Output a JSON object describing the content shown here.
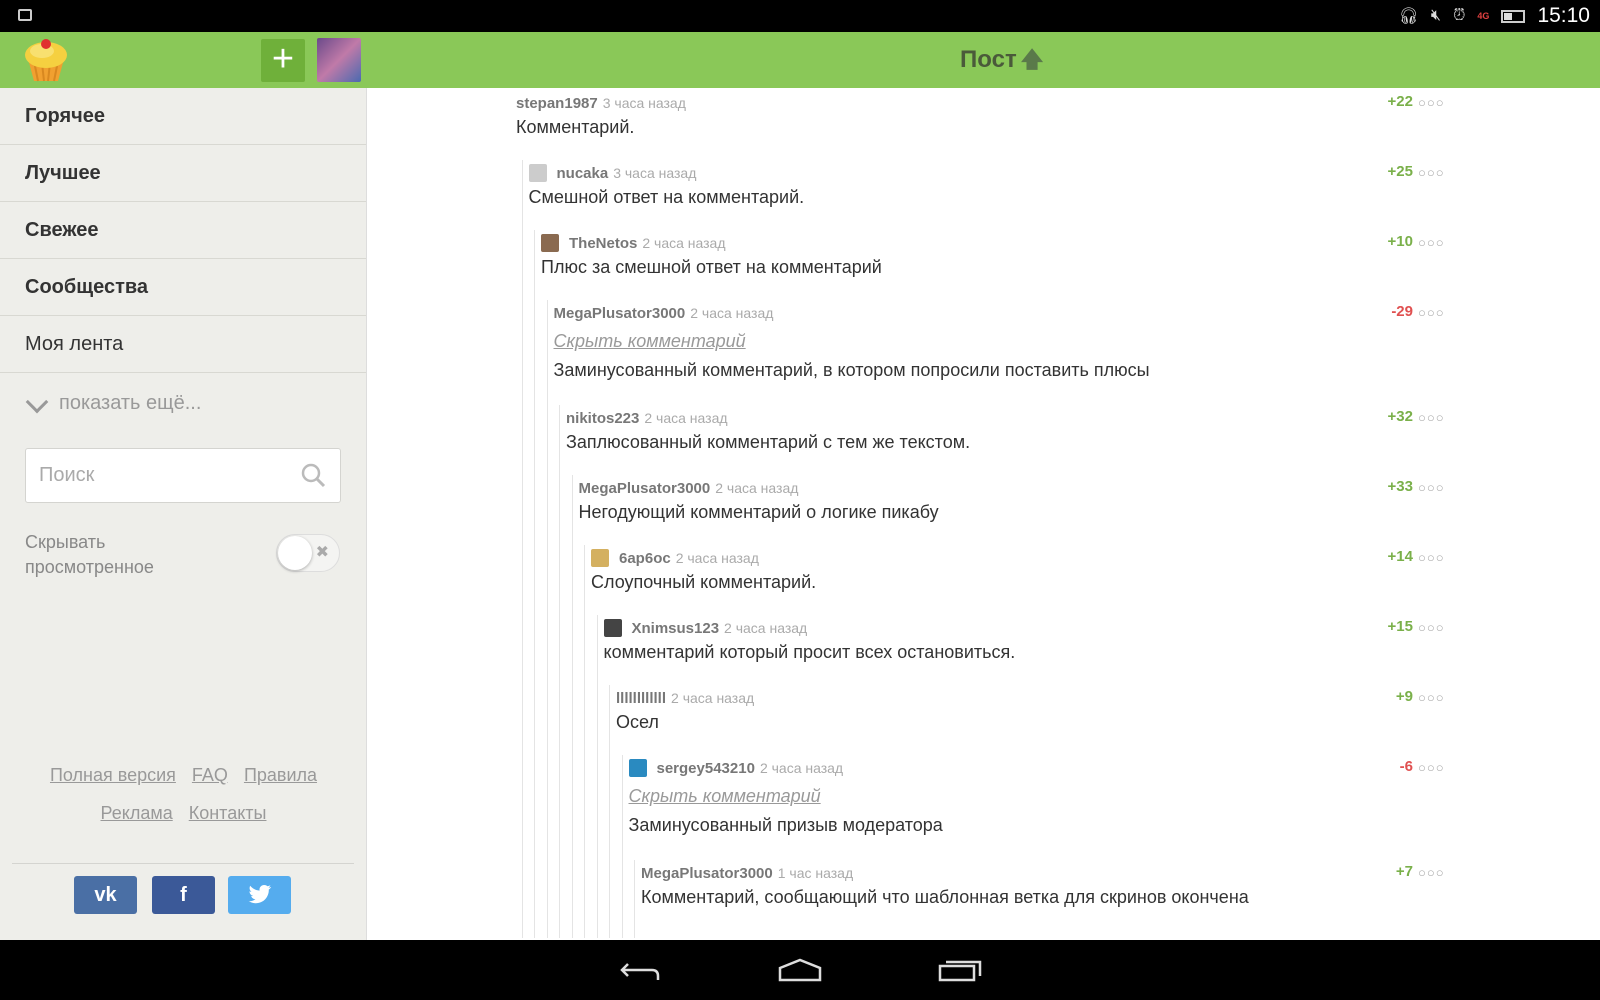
{
  "statusbar": {
    "time": "15:10",
    "network": "4G",
    "network_color": "#e04040"
  },
  "header": {
    "title": "Пост",
    "arrow": "🡅",
    "background": "#8ac858",
    "add_label": "+"
  },
  "sidebar": {
    "nav": [
      {
        "label": "Горячее",
        "bold": true
      },
      {
        "label": "Лучшее",
        "bold": true
      },
      {
        "label": "Свежее",
        "bold": true
      },
      {
        "label": "Сообщества",
        "bold": true
      },
      {
        "label": "Моя лента",
        "bold": false
      }
    ],
    "show_more": "показать ещё...",
    "search_placeholder": "Поиск",
    "hide_viewed_label": "Скрывать просмотренное",
    "hide_viewed_on": false,
    "footer_links_row1": [
      "Полная версия",
      "FAQ",
      "Правила"
    ],
    "footer_links_row2": [
      "Реклама",
      "Контакты"
    ],
    "social": [
      "vk-icon",
      "facebook-icon",
      "twitter-icon"
    ]
  },
  "comments": [
    {
      "author": "stepan1987",
      "time": "3 часа назад",
      "rating": "+22",
      "text": "Комментарий.",
      "avatar": false,
      "hidden": false
    },
    {
      "author": "nucaka",
      "time": "3 часа назад",
      "rating": "+25",
      "text": "Смешной ответ на комментарий.",
      "avatar": true,
      "hidden": false
    },
    {
      "author": "TheNetos",
      "time": "2 часа назад",
      "rating": "+10",
      "text": "Плюс за смешной ответ на комментарий",
      "avatar": true,
      "hidden": false
    },
    {
      "author": "MegaPlusator3000",
      "time": "2 часа назад",
      "rating": "-29",
      "text": "Заминусованный комментарий, в котором попросили поставить плюсы",
      "avatar": false,
      "hidden": true,
      "hide_label": "Скрыть комментарий"
    },
    {
      "author": "nikitos223",
      "time": "2 часа назад",
      "rating": "+32",
      "text": "Заплюсованный комментарий с тем же текстом.",
      "avatar": false,
      "hidden": false
    },
    {
      "author": "MegaPlusator3000",
      "time": "2 часа назад",
      "rating": "+33",
      "text": "Негодующий комментарий о логике пикабу",
      "avatar": false,
      "hidden": false
    },
    {
      "author": "6ap6oc",
      "time": "2 часа назад",
      "rating": "+14",
      "text": "Слоупочный комментарий.",
      "avatar": true,
      "hidden": false
    },
    {
      "author": "Xnimsus123",
      "time": "2 часа назад",
      "rating": "+15",
      "text": "комментарий который просит всех остановиться.",
      "avatar": true,
      "hidden": false
    },
    {
      "author": "llllllllllll",
      "time": "2 часа назад",
      "rating": "+9",
      "text": "Осел",
      "avatar": false,
      "hidden": false
    },
    {
      "author": "sergey543210",
      "time": "2 часа назад",
      "rating": "-6",
      "text": "Заминусованный призыв модератора",
      "avatar": true,
      "hidden": true,
      "hide_label": "Скрыть комментарий"
    },
    {
      "author": "MegaPlusator3000",
      "time": "1 час назад",
      "rating": "+7",
      "text": "Комментарий, сообщающий что шаблонная ветка для скринов окончена",
      "avatar": false,
      "hidden": false
    }
  ],
  "colors": {
    "positive": "#7ab04a",
    "negative": "#e05050"
  }
}
